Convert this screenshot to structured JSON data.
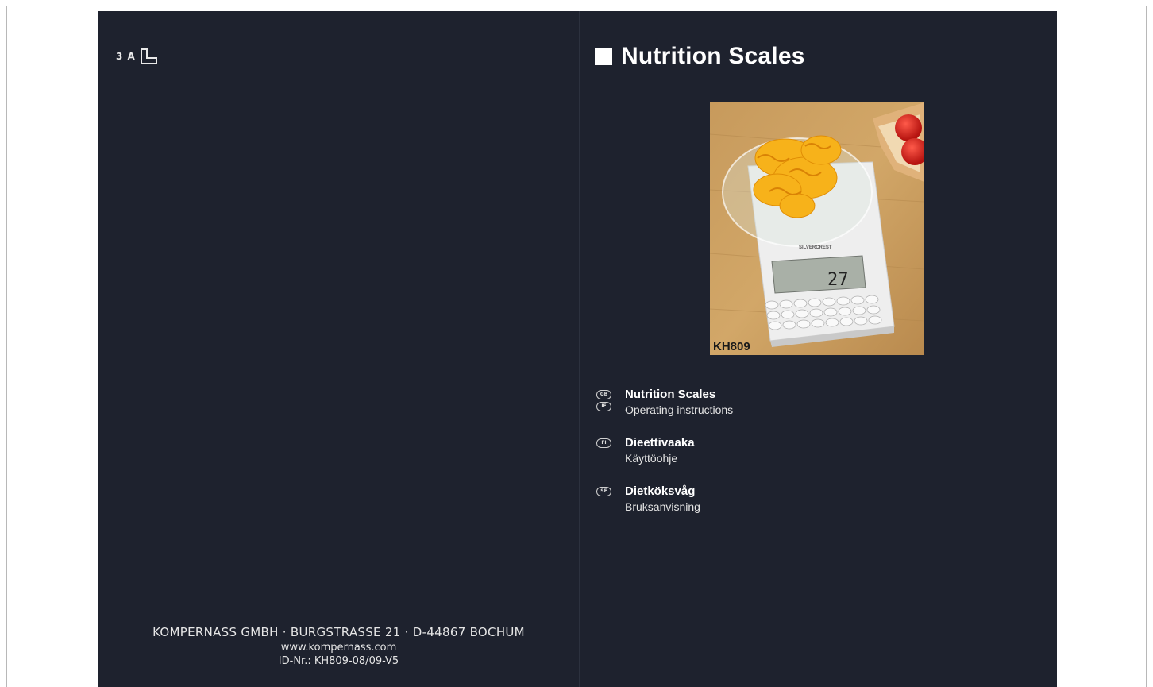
{
  "left_page": {
    "fold_mark_text": "3 A",
    "fold_icon": "corner-fold-icon",
    "address_line1": "KOMPERNASS GMBH · BURGSTRASSE 21 · D-44867 BOCHUM",
    "address_line2": "www.kompernass.com",
    "address_line3": "ID-Nr.: KH809-08/09-V5"
  },
  "right_page": {
    "title": "Nutrition Scales",
    "product_image": {
      "model_label": "KH809",
      "display_reading": "27"
    },
    "languages": [
      {
        "codes": [
          "GB",
          "IE"
        ],
        "name": "Nutrition Scales",
        "subtitle": "Operating instructions"
      },
      {
        "codes": [
          "FI"
        ],
        "name": "Dieettivaaka",
        "subtitle": "Käyttöohje"
      },
      {
        "codes": [
          "SE"
        ],
        "name": "Dietköksvåg",
        "subtitle": "Bruksanvisning"
      }
    ]
  },
  "colors": {
    "background": "#1e222e",
    "text": "#ffffff"
  }
}
